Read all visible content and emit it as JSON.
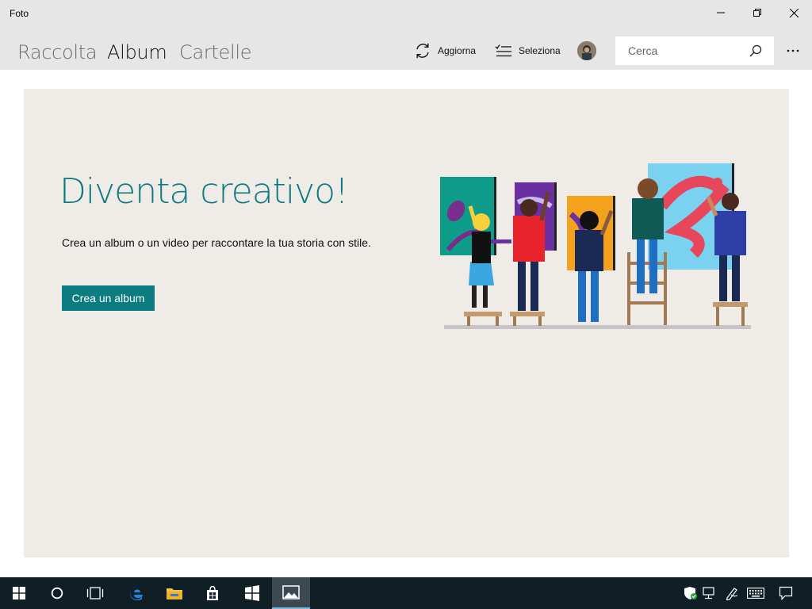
{
  "window": {
    "title": "Foto"
  },
  "nav": {
    "tabs": [
      {
        "label": "Raccolta",
        "active": false
      },
      {
        "label": "Album",
        "active": true
      },
      {
        "label": "Cartelle",
        "active": false
      }
    ]
  },
  "commands": {
    "refresh_label": "Aggiorna",
    "select_label": "Seleziona"
  },
  "search": {
    "placeholder": "Cerca"
  },
  "hero": {
    "title": "Diventa creativo!",
    "description": "Crea un album o un video per raccontare la tua storia con stile.",
    "cta_label": "Crea un album"
  },
  "colors": {
    "accent": "#0b7d80",
    "title_teal": "#0f7a7f",
    "card_bg": "#efebe7",
    "chrome_bg": "#e6e6e6",
    "taskbar_bg": "#0f1f25"
  },
  "taskbar": {
    "icons": [
      "windows-start-icon",
      "cortana-icon",
      "task-view-icon",
      "edge-icon",
      "file-explorer-icon",
      "store-icon",
      "tablet-app-icon",
      "photos-icon"
    ],
    "tray_icons": [
      "defender-shield-icon",
      "network-icon",
      "pen-icon",
      "keyboard-icon",
      "action-center-icon"
    ]
  }
}
